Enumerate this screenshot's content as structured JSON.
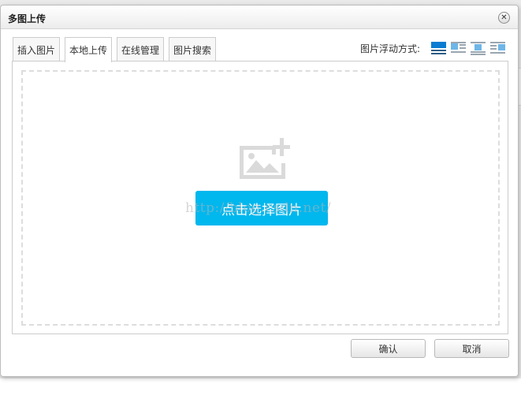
{
  "dialog": {
    "title": "多图上传",
    "close_glyph": "✕"
  },
  "tabs": [
    {
      "label": "插入图片",
      "active": false
    },
    {
      "label": "本地上传",
      "active": true
    },
    {
      "label": "在线管理",
      "active": false
    },
    {
      "label": "图片搜索",
      "active": false
    }
  ],
  "float": {
    "label": "图片浮动方式:",
    "options": [
      "none",
      "left",
      "center",
      "right"
    ],
    "selected": "none"
  },
  "upload": {
    "pick_label": "点击选择图片",
    "watermark": "http://blog.csdn.net/"
  },
  "footer": {
    "ok_label": "确认",
    "cancel_label": "取消"
  },
  "colors": {
    "accent": "#00b7ee",
    "icon_gray": "#d9d9d9",
    "float_icon_blue": "#6eb6e8"
  }
}
